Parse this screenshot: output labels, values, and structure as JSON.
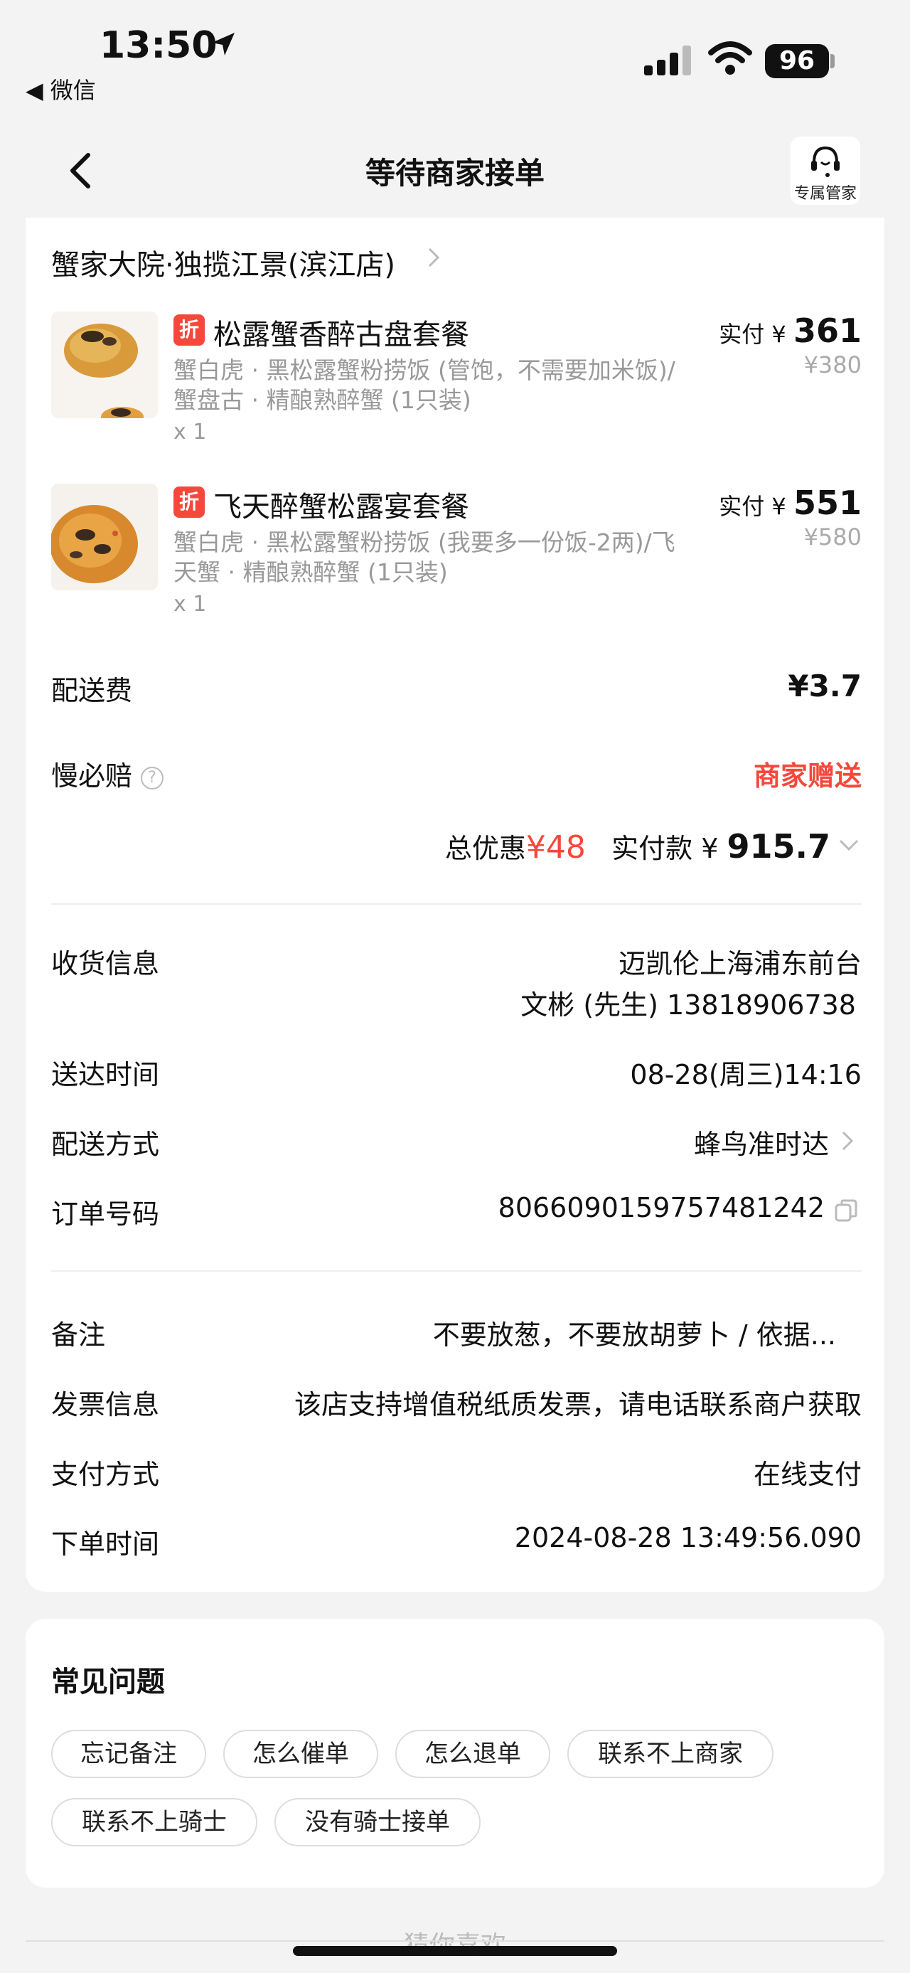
{
  "status_bar": {
    "time": "13:50",
    "back_app": "◀ 微信",
    "battery": "96"
  },
  "nav": {
    "title": "等待商家接单",
    "service_label": "专属管家"
  },
  "store": {
    "name": "蟹家大院·独揽江景(滨江店)"
  },
  "items": [
    {
      "tag": "折",
      "name": "松露蟹香醉古盘套餐",
      "desc": "蟹白虎 · 黑松露蟹粉捞饭 (管饱，不需要加米饭)/蟹盘古 · 精酿熟醉蟹 (1只装)",
      "qty": "x 1",
      "paid_label": "实付 ¥ ",
      "paid": "361",
      "original": "¥380"
    },
    {
      "tag": "折",
      "name": "飞天醉蟹松露宴套餐",
      "desc": "蟹白虎 · 黑松露蟹粉捞饭 (我要多一份饭-2两)/飞天蟹 · 精酿熟醉蟹 (1只装)",
      "qty": "x 1",
      "paid_label": "实付 ¥ ",
      "paid": "551",
      "original": "¥580"
    }
  ],
  "fees": {
    "delivery_label": "配送费",
    "delivery_value": "¥3.7",
    "slow_label": "慢必赔",
    "slow_value": "商家赠送",
    "discount_label": "总优惠",
    "discount_value": "¥48",
    "total_label": "实付款 ¥ ",
    "total_value": "915.7"
  },
  "details": {
    "receiver_label": "收货信息",
    "receiver_addr": "迈凯伦上海浦东前台",
    "receiver_person": "文彬 (先生) 13818906738",
    "arrival_label": "送达时间",
    "arrival_value": "08-28(周三)14:16",
    "method_label": "配送方式",
    "method_value": "蜂鸟准时达",
    "order_label": "订单号码",
    "order_value": "8066090159757481242",
    "note_label": "备注",
    "note_value": "不要放葱，不要放胡萝卜 / 依据...",
    "invoice_label": "发票信息",
    "invoice_value": "该店支持增值税纸质发票，请电话联系商户获取",
    "pay_label": "支付方式",
    "pay_value": "在线支付",
    "time_label": "下单时间",
    "time_value": "2024-08-28 13:49:56.090"
  },
  "faq": {
    "title": "常见问题",
    "chips": [
      "忘记备注",
      "怎么催单",
      "怎么退单",
      "联系不上商家",
      "联系不上骑士",
      "没有骑士接单"
    ]
  },
  "footer": {
    "guess": "猜你喜欢"
  },
  "colors": {
    "accent": "#f5483b",
    "background": "#f3f3f3",
    "muted": "#999999"
  }
}
